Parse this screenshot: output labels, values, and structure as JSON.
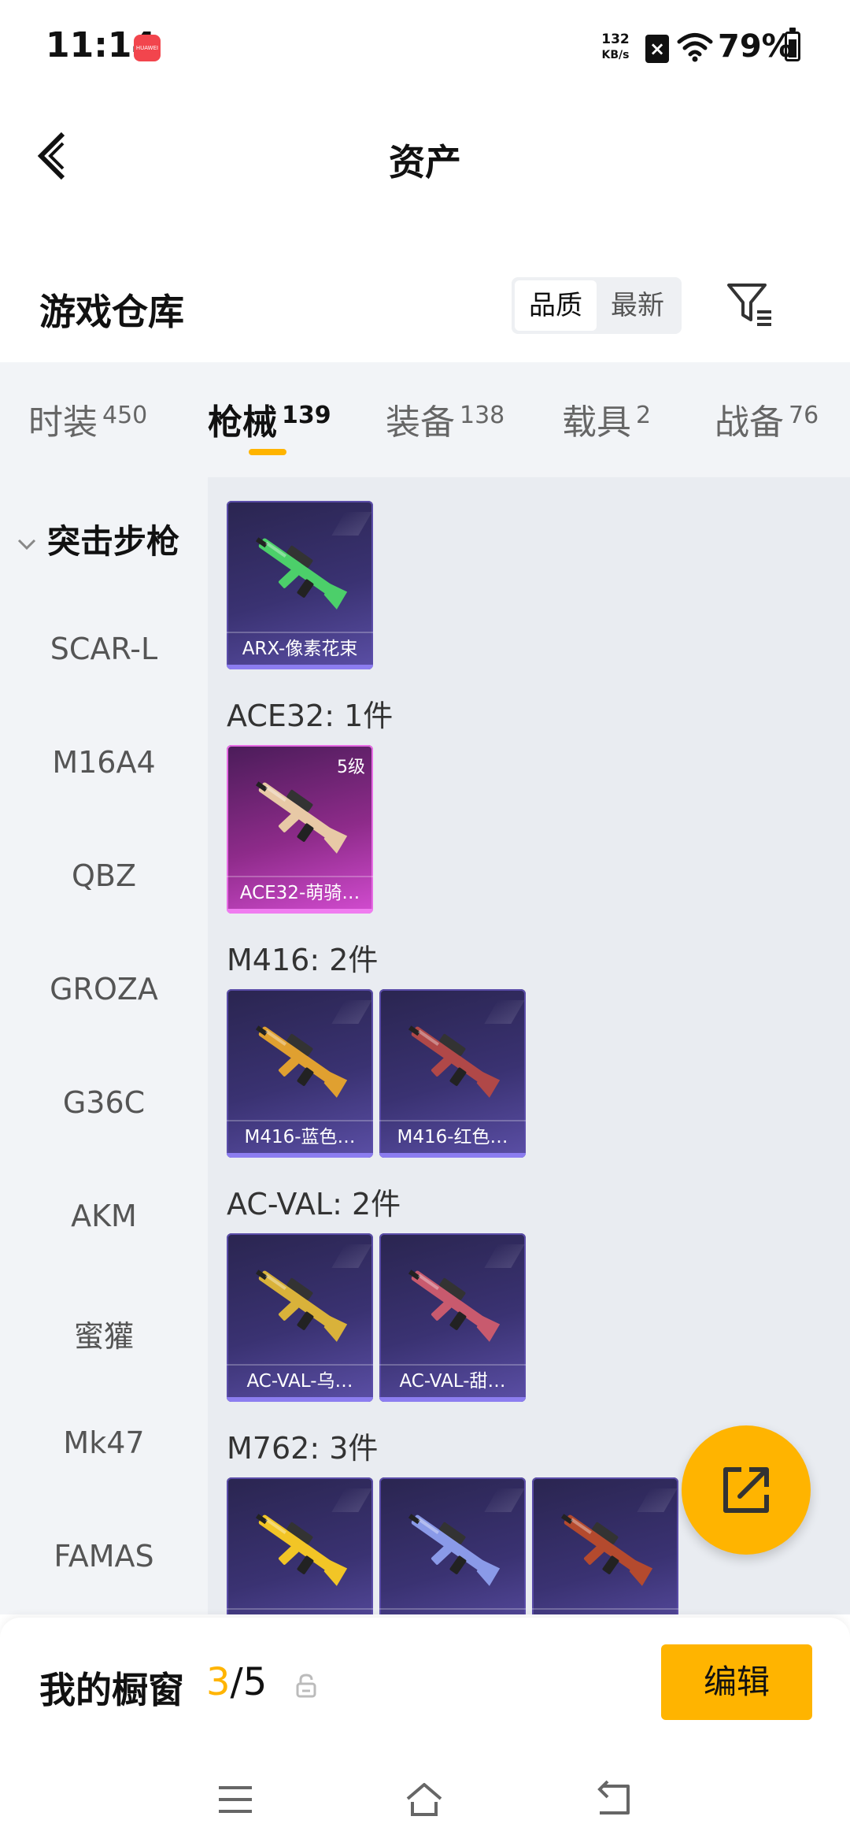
{
  "status_bar": {
    "time": "11:14",
    "app_badge": "HUAWEI",
    "net_speed": "132",
    "net_unit": "KB/s",
    "battery": "79%"
  },
  "header": {
    "title": "资产"
  },
  "warehouse": {
    "title": "游戏仓库",
    "sort_options": [
      "品质",
      "最新"
    ],
    "active_sort": "品质"
  },
  "tabs": [
    {
      "label": "时装",
      "count": "450"
    },
    {
      "label": "枪械",
      "count": "139",
      "active": true
    },
    {
      "label": "装备",
      "count": "138"
    },
    {
      "label": "载具",
      "count": "2"
    },
    {
      "label": "战备",
      "count": "76"
    }
  ],
  "sidebar": {
    "category": "突击步枪",
    "items": [
      "SCAR-L",
      "M16A4",
      "QBZ",
      "GROZA",
      "G36C",
      "AKM",
      "蜜獾",
      "Mk47",
      "FAMAS"
    ]
  },
  "groups": [
    {
      "label": "",
      "items": [
        {
          "name": "ARX-像素花束",
          "color": "#4ccf6a",
          "rarity": "purple"
        }
      ]
    },
    {
      "label": "ACE32: 1件",
      "items": [
        {
          "name": "ACE32-萌骑…",
          "level": "5级",
          "color": "#e8c9a6",
          "rarity": "pink"
        }
      ]
    },
    {
      "label": "M416: 2件",
      "items": [
        {
          "name": "M416-蓝色…",
          "color": "#e0a030",
          "rarity": "purple"
        },
        {
          "name": "M416-红色…",
          "color": "#b04848",
          "rarity": "purple"
        }
      ]
    },
    {
      "label": "AC-VAL: 2件",
      "items": [
        {
          "name": "AC-VAL-乌…",
          "color": "#d9b23a",
          "rarity": "purple"
        },
        {
          "name": "AC-VAL-甜…",
          "color": "#c85a6e",
          "rarity": "purple"
        }
      ]
    },
    {
      "label": "M762: 3件",
      "items": [
        {
          "name": "",
          "color": "#f2c526",
          "rarity": "purple"
        },
        {
          "name": "",
          "color": "#8a9ae8",
          "rarity": "purple"
        },
        {
          "name": "",
          "color": "#b44a2e",
          "rarity": "purple"
        }
      ]
    }
  ],
  "showcase": {
    "label": "我的橱窗",
    "current": "3",
    "total": "/5",
    "edit_label": "编辑"
  },
  "colors": {
    "accent": "#ffb400",
    "card_purple": "#3a3272",
    "card_pink": "#8e2b8a"
  }
}
